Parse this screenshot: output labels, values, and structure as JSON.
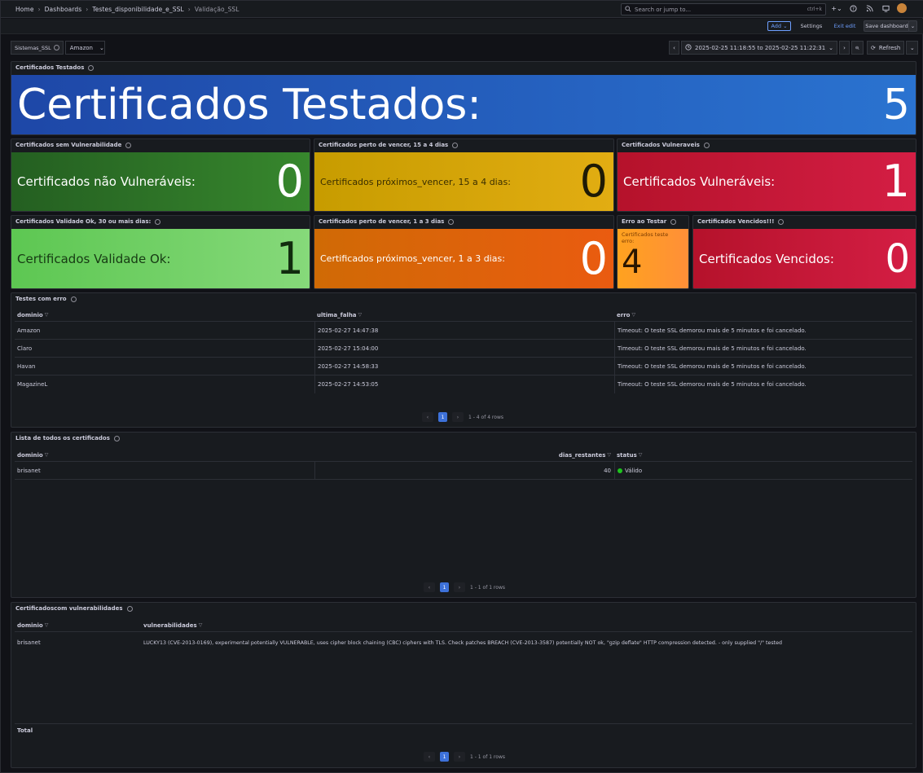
{
  "breadcrumb": [
    "Home",
    "Dashboards",
    "Testes_disponibilidade_e_SSL",
    "Validação_SSL"
  ],
  "search": {
    "placeholder": "Search or jump to...",
    "shortcut": "ctrl+k"
  },
  "toolbar": {
    "add_label": "Add",
    "settings_label": "Settings",
    "exit_label": "Exit edit",
    "save_label": "Save dashboard"
  },
  "variables": {
    "label": "Sistemas_SSL",
    "value": "Amazon"
  },
  "timerange": {
    "range": "2025-02-25 11:18:55 to 2025-02-25 11:22:31",
    "refresh_label": "Refresh"
  },
  "panels": {
    "total": {
      "title": "Certificados Testados",
      "label": "Certificados Testados:",
      "value": "5",
      "color": "#2563c7"
    },
    "no_vuln": {
      "title": "Certificados sem Vulnerabilidade",
      "label": "Certificados não Vulneráveis:",
      "value": "0",
      "color": "#37872d"
    },
    "expire_15": {
      "title": "Certificados perto de vencer, 15 a 4 dias",
      "label": "Certificados próximos_vencer, 15 a 4 dias:",
      "value": "0",
      "color": "#e0b400"
    },
    "vuln": {
      "title": "Certificados Vulneraveis",
      "label": "Certificados Vulneráveis:",
      "value": "1",
      "color": "#c4162a"
    },
    "valid": {
      "title": "Certificados Validade Ok, 30 ou mais dias:",
      "label": "Certificados Validade Ok:",
      "value": "1",
      "color": "#73bf69"
    },
    "expire_3": {
      "title": "Certificados perto de vencer, 1 a 3 dias",
      "label": "Certificados próximos_vencer, 1 a 3 dias:",
      "value": "0",
      "color": "#f2670f"
    },
    "errors": {
      "title": "Erro ao Testar",
      "label": "Certificados teste erro:",
      "value": "4",
      "color": "#ff9830"
    },
    "expired": {
      "title": "Certificados Vencidos!!!",
      "label": "Certificados Vencidos:",
      "value": "0",
      "color": "#c4162a"
    }
  },
  "errors_table": {
    "title": "Testes com erro",
    "columns": [
      "dominio",
      "ultima_falha",
      "erro"
    ],
    "rows": [
      [
        "Amazon",
        "2025-02-27 14:47:38",
        "Timeout: O teste SSL demorou mais de 5 minutos e foi cancelado."
      ],
      [
        "Claro",
        "2025-02-27 15:04:00",
        "Timeout: O teste SSL demorou mais de 5 minutos e foi cancelado."
      ],
      [
        "Havan",
        "2025-02-27 14:58:33",
        "Timeout: O teste SSL demorou mais de 5 minutos e foi cancelado."
      ],
      [
        "MagazineL",
        "2025-02-27 14:53:05",
        "Timeout: O teste SSL demorou mais de 5 minutos e foi cancelado."
      ]
    ],
    "page": "1",
    "rows_info": "1 - 4 of 4 rows"
  },
  "certs_table": {
    "title": "Lista de todos os certificados",
    "columns": [
      "dominio",
      "dias_restantes",
      "status"
    ],
    "rows": [
      [
        "brisanet",
        "40",
        "Válido"
      ]
    ],
    "page": "1",
    "rows_info": "1 - 1 of 1 rows"
  },
  "vuln_table": {
    "title": "Certificadoscom vulnerabilidades",
    "columns": [
      "dominio",
      "vulnerabilidades"
    ],
    "rows": [
      [
        "brisanet",
        "LUCKY13 (CVE-2013-0169), experimental potentially VULNERABLE, uses cipher block chaining (CBC) ciphers with TLS. Check patches BREACH (CVE-2013-3587) potentially NOT ok, \"gzip deflate\" HTTP compression detected. - only supplied \"/\" tested"
      ]
    ],
    "footer": "Total",
    "page": "1",
    "rows_info": "1 - 1 of 1 rows"
  }
}
